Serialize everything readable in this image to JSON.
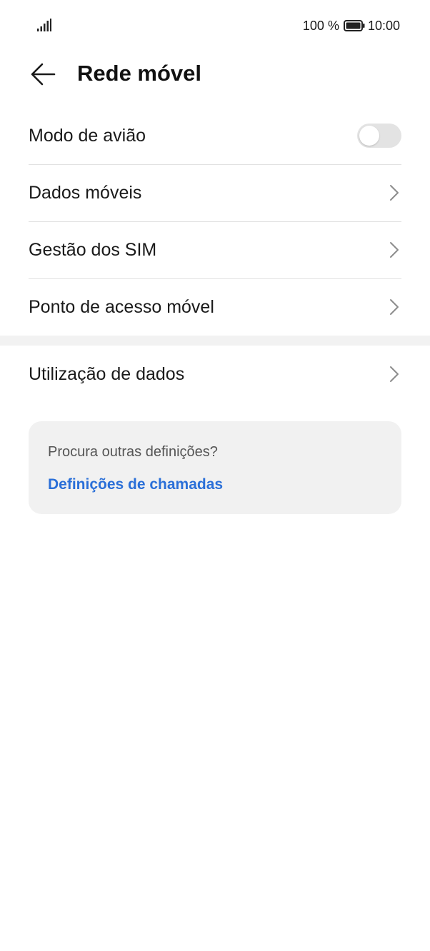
{
  "status_bar": {
    "battery_percent": "100 %",
    "time": "10:00",
    "signal_icon": "signal-bars-icon",
    "battery_icon": "battery-full-icon"
  },
  "header": {
    "back_icon": "arrow-left-icon",
    "title": "Rede móvel"
  },
  "settings": {
    "airplane_mode": {
      "label": "Modo de avião",
      "enabled": false
    },
    "items": [
      {
        "label": "Dados móveis"
      },
      {
        "label": "Gestão dos SIM"
      },
      {
        "label": "Ponto de acesso móvel"
      }
    ],
    "data_usage": {
      "label": "Utilização de dados"
    }
  },
  "suggestion_card": {
    "question": "Procura outras definições?",
    "link_label": "Definições de chamadas"
  },
  "colors": {
    "accent_link": "#2a6fd8",
    "toggle_off": "#e3e3e3",
    "card_background": "#f1f1f1"
  }
}
